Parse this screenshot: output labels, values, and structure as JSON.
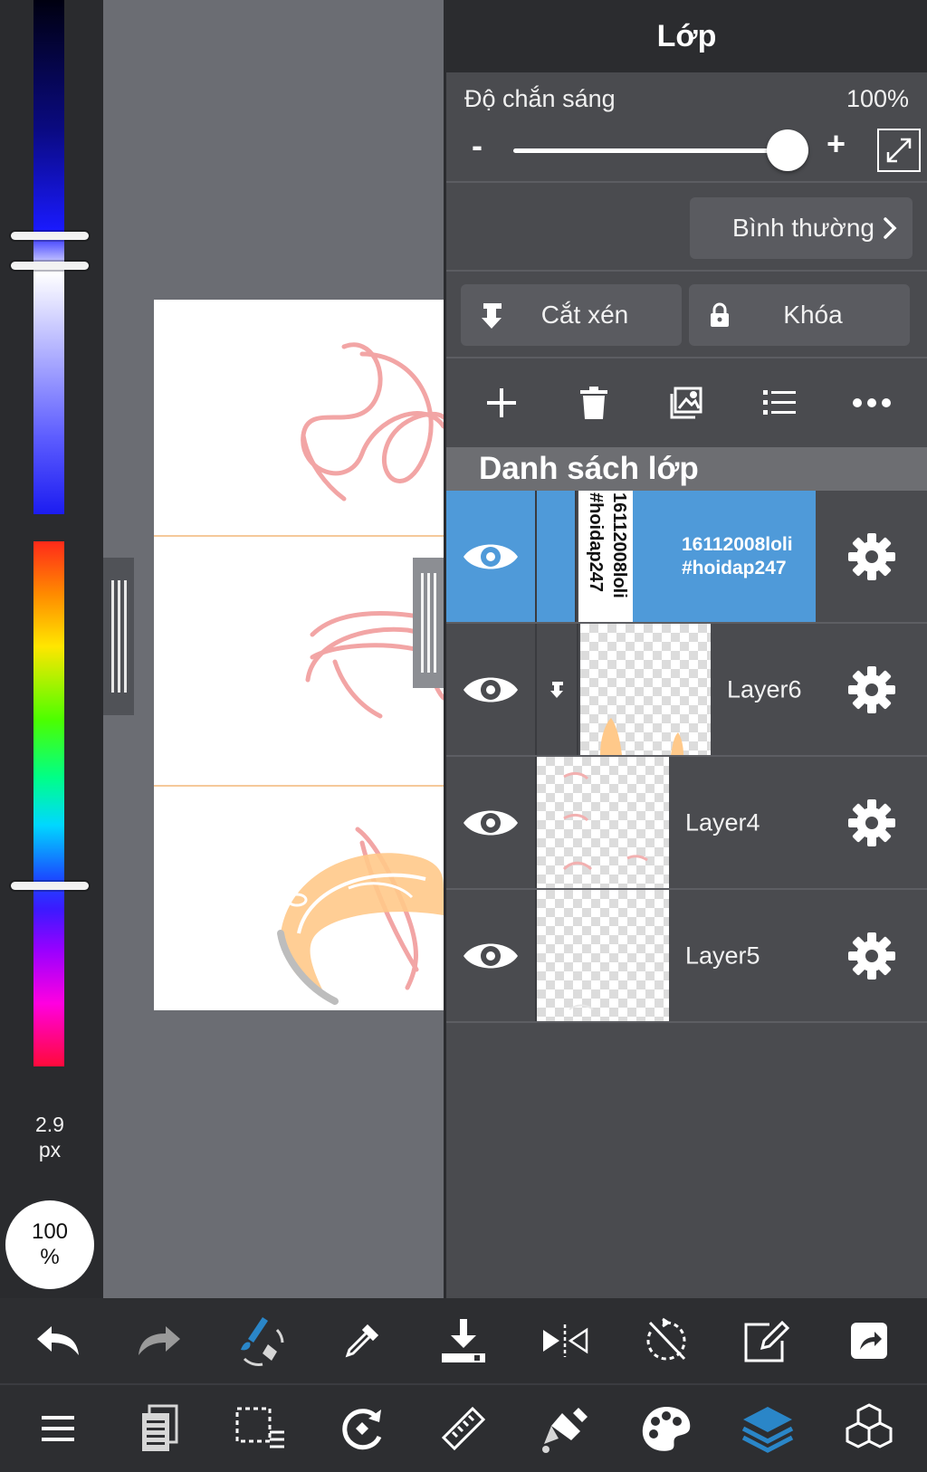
{
  "left_strip": {
    "brush_size_value": "2.9",
    "brush_size_unit": "px",
    "brush_opacity_value": "100",
    "brush_opacity_unit": "%"
  },
  "layer_panel": {
    "title": "Lớp",
    "opacity": {
      "label": "Độ chắn sáng",
      "value": "100%",
      "minus": "-",
      "plus": "+",
      "level_percent": 100
    },
    "blend_mode": "Bình thường",
    "clipping_label": "Cắt xén",
    "lock_label": "Khóa",
    "tools": [
      "add-layer",
      "delete-layer",
      "layer-image",
      "layer-list",
      "more"
    ],
    "list_header": "Danh sách lớp",
    "layers": [
      {
        "name_line1": "16112008loli",
        "name_line2": "#hoidap247",
        "thumb_line1": "16112008loli",
        "thumb_line2": "#hoidap247",
        "selected": true,
        "visible": true,
        "clipped": false
      },
      {
        "name": "Layer6",
        "selected": false,
        "visible": true,
        "clipped": true
      },
      {
        "name": "Layer4",
        "selected": false,
        "visible": true,
        "clipped": false
      },
      {
        "name": "Layer5",
        "selected": false,
        "visible": true,
        "clipped": false
      }
    ]
  },
  "colors": {
    "accent_blue": "#4f9ad9",
    "sketch_pink": "#f2a5a5",
    "skin_peach": "#ffc98a"
  },
  "bottom_toolbar": {
    "row1": [
      "undo-icon",
      "redo-icon",
      "brush-transform-icon",
      "eyedropper-icon",
      "import-icon",
      "flip-icon",
      "snap-off-icon",
      "edit-icon",
      "export-icon"
    ],
    "row2": [
      "menu-icon",
      "pages-icon",
      "selection-icon",
      "rotate-view-icon",
      "ruler-icon",
      "paint-bucket-icon",
      "palette-icon",
      "layers-icon",
      "materials-icon"
    ]
  }
}
